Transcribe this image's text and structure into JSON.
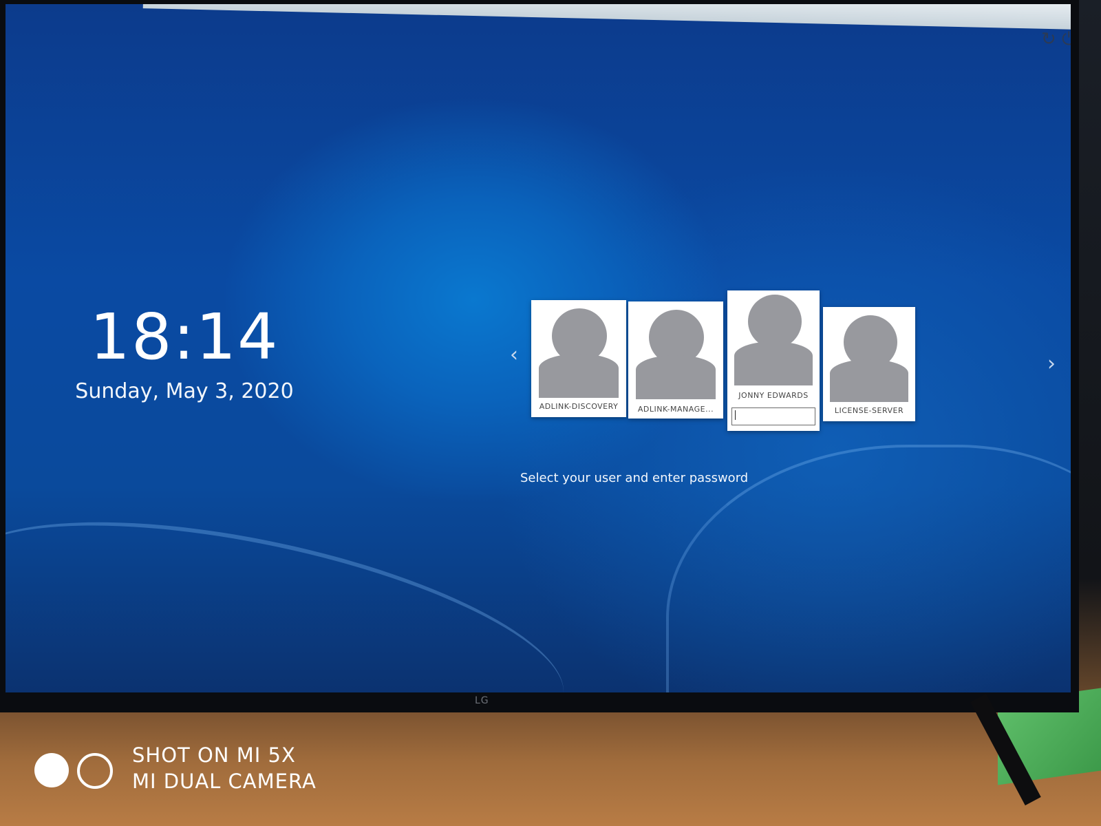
{
  "clock": {
    "time": "18:14",
    "date": "Sunday, May 3, 2020"
  },
  "login": {
    "users": [
      {
        "name": "ADLINK-DISCOVERY"
      },
      {
        "name": "ADLINK-MANAGE..."
      },
      {
        "name": "JONNY EDWARDS",
        "password_value": ""
      },
      {
        "name": "LICENSE-SERVER"
      }
    ],
    "hint": "Select your user and enter password",
    "prev_icon": "chevron-left-icon",
    "next_icon": "chevron-right-icon"
  },
  "system_buttons": {
    "restart_icon": "restart-icon",
    "shutdown_icon": "power-icon"
  },
  "monitor": {
    "brand": "LG"
  },
  "watermark": {
    "line1": "SHOT ON MI 5X",
    "line2": "MI DUAL CAMERA"
  },
  "colors": {
    "background": "#0a4aa3",
    "card": "#ffffff",
    "avatar": "#98999e"
  }
}
